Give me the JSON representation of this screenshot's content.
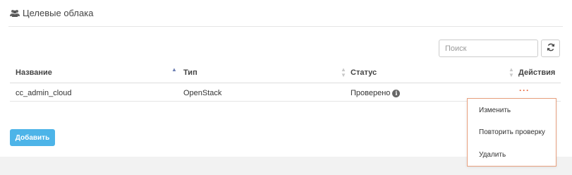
{
  "header": {
    "title": "Целевые облака",
    "icon": "users-icon"
  },
  "toolbar": {
    "search_placeholder": "Поиск",
    "refresh_icon": "refresh-icon"
  },
  "table": {
    "columns": [
      "Название",
      "Тип",
      "Статус",
      "Действия"
    ],
    "rows": [
      {
        "name": "cc_admin_cloud",
        "type": "OpenStack",
        "status": "Проверено",
        "actions": "···"
      }
    ]
  },
  "add_button": "Добавить",
  "menu": {
    "items": [
      "Изменить",
      "Повторить проверку",
      "Удалить"
    ]
  },
  "colors": {
    "accent": "#4db4e8",
    "menu_border": "#e8a07e",
    "actions": "#e8663a"
  }
}
